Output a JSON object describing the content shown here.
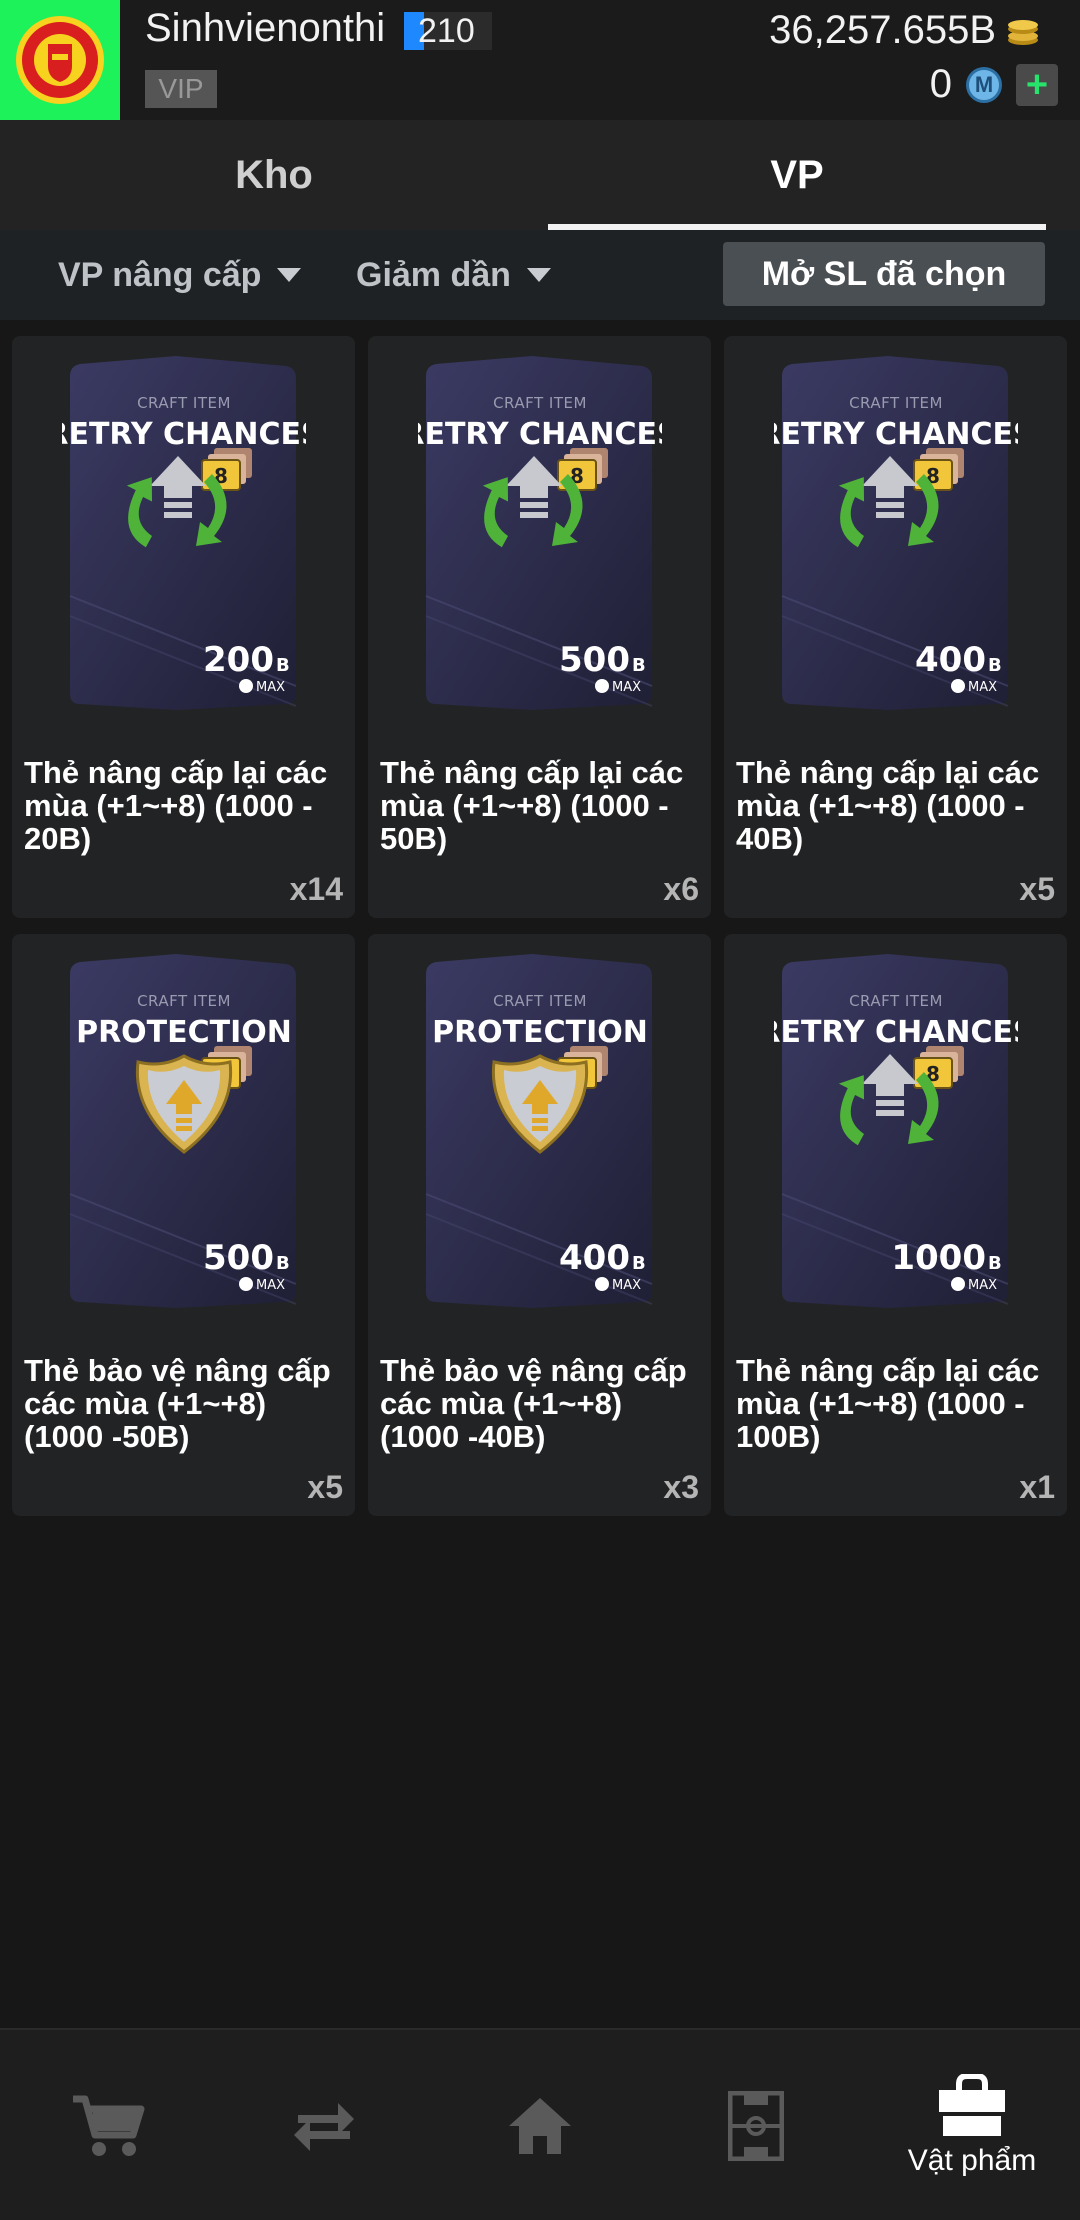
{
  "header": {
    "username": "Sinhvienonthi",
    "level": "210",
    "vip_label": "VIP",
    "coins": "36,257.655B",
    "mcoins": "0"
  },
  "tabs": [
    {
      "label": "Kho",
      "active": false
    },
    {
      "label": "VP",
      "active": true
    }
  ],
  "filters": {
    "category": "VP nâng cấp",
    "sort": "Giảm dần",
    "open_selected_label": "Mở SL đã chọn"
  },
  "items": [
    {
      "kicker": "CRAFT ITEM",
      "kind": "RETRY CHANCES",
      "icon": "retry-arrows-icon",
      "value": "200",
      "unit": "B",
      "max": "MAX",
      "level": "8",
      "title": "Thẻ nâng cấp lại các mùa (+1~+8) (1000 - 20B)",
      "qty": "x14"
    },
    {
      "kicker": "CRAFT ITEM",
      "kind": "RETRY CHANCES",
      "icon": "retry-arrows-icon",
      "value": "500",
      "unit": "B",
      "max": "MAX",
      "level": "8",
      "title": "Thẻ nâng cấp lại các mùa (+1~+8) (1000 - 50B)",
      "qty": "x6"
    },
    {
      "kicker": "CRAFT ITEM",
      "kind": "RETRY CHANCES",
      "icon": "retry-arrows-icon",
      "value": "400",
      "unit": "B",
      "max": "MAX",
      "level": "8",
      "title": "Thẻ nâng cấp lại các mùa (+1~+8) (1000 - 40B)",
      "qty": "x5"
    },
    {
      "kicker": "CRAFT ITEM",
      "kind": "PROTECTION",
      "icon": "shield-icon",
      "value": "500",
      "unit": "B",
      "max": "MAX",
      "level": "8",
      "title": "Thẻ bảo vệ nâng cấp các mùa (+1~+8) (1000 -50B)",
      "qty": "x5"
    },
    {
      "kicker": "CRAFT ITEM",
      "kind": "PROTECTION",
      "icon": "shield-icon",
      "value": "400",
      "unit": "B",
      "max": "MAX",
      "level": "8",
      "title": "Thẻ bảo vệ nâng cấp các mùa (+1~+8) (1000 -40B)",
      "qty": "x3"
    },
    {
      "kicker": "CRAFT ITEM",
      "kind": "RETRY CHANCES",
      "icon": "retry-arrows-icon",
      "value": "1000",
      "unit": "B",
      "max": "MAX",
      "level": "8",
      "title": "Thẻ nâng cấp lại các mùa (+1~+8) (1000 - 100B)",
      "qty": "x1"
    }
  ],
  "bottom_nav": [
    {
      "icon": "cart-icon",
      "label": ""
    },
    {
      "icon": "transfer-icon",
      "label": ""
    },
    {
      "icon": "home-icon",
      "label": ""
    },
    {
      "icon": "pitch-icon",
      "label": ""
    },
    {
      "icon": "bag-icon",
      "label": "Vật phẩm",
      "active": true
    }
  ],
  "colors": {
    "logo_bg": "#1ef25a",
    "level_bar": "#1e88ff",
    "plus": "#27e36b",
    "card_bg": "#222325"
  }
}
